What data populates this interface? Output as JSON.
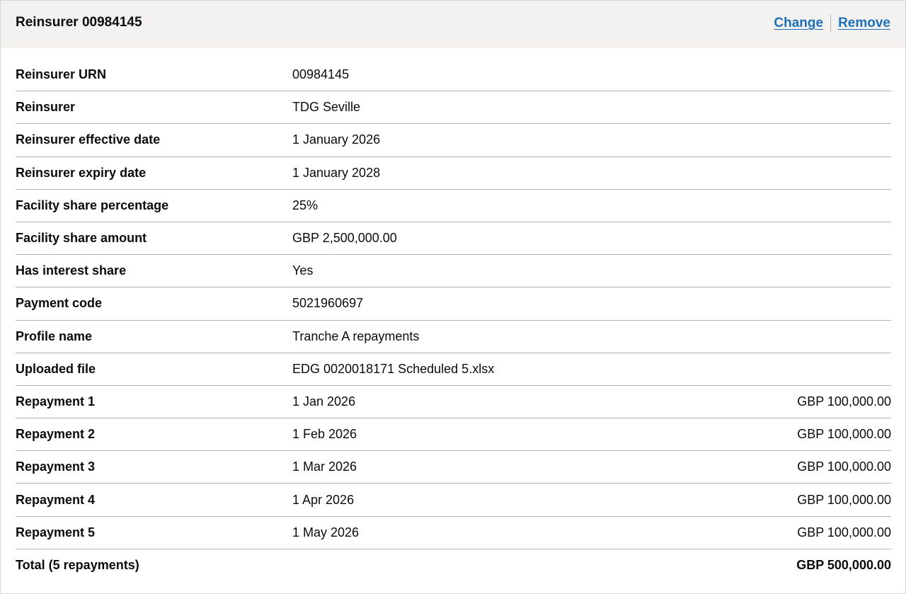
{
  "header": {
    "title": "Reinsurer 00984145",
    "change_label": "Change",
    "remove_label": "Remove"
  },
  "details": [
    {
      "key": "Reinsurer URN",
      "value": "00984145"
    },
    {
      "key": "Reinsurer",
      "value": "TDG Seville"
    },
    {
      "key": "Reinsurer effective date",
      "value": "1 January 2026"
    },
    {
      "key": "Reinsurer expiry date",
      "value": "1 January 2028"
    },
    {
      "key": "Facility share percentage",
      "value": "25%"
    },
    {
      "key": "Facility share amount",
      "value": "GBP 2,500,000.00"
    },
    {
      "key": "Has interest share",
      "value": "Yes"
    },
    {
      "key": "Payment code",
      "value": "5021960697"
    },
    {
      "key": "Profile name",
      "value": "Tranche A repayments"
    },
    {
      "key": "Uploaded file",
      "value": "EDG 0020018171 Scheduled 5.xlsx"
    }
  ],
  "repayments": [
    {
      "key": "Repayment 1",
      "date": "1 Jan 2026",
      "amount": "GBP 100,000.00"
    },
    {
      "key": "Repayment 2",
      "date": "1 Feb 2026",
      "amount": "GBP 100,000.00"
    },
    {
      "key": "Repayment 3",
      "date": "1 Mar 2026",
      "amount": "GBP 100,000.00"
    },
    {
      "key": "Repayment 4",
      "date": "1 Apr 2026",
      "amount": "GBP 100,000.00"
    },
    {
      "key": "Repayment 5",
      "date": "1 May 2026",
      "amount": "GBP 100,000.00"
    }
  ],
  "total": {
    "key": "Total (5 repayments)",
    "amount": "GBP 500,000.00"
  }
}
